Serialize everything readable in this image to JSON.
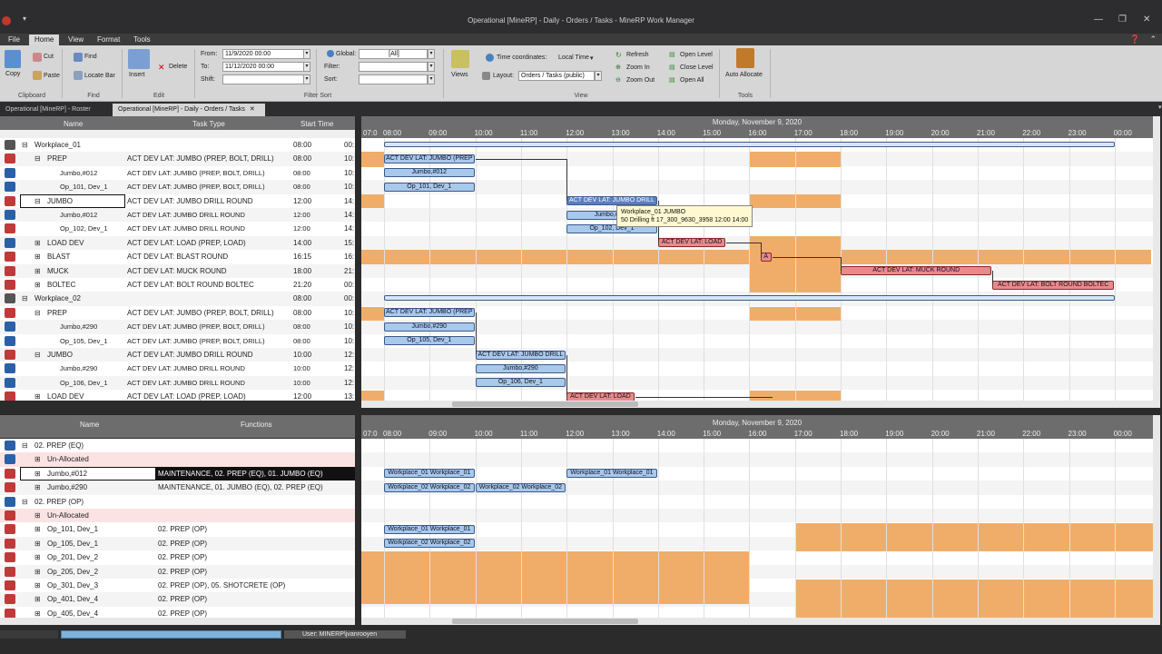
{
  "title": "Operational [MineRP] - Daily - Orders / Tasks - MineRP Work Manager",
  "menu": [
    "File",
    "Home",
    "View",
    "Format",
    "Tools"
  ],
  "ribbon": {
    "copy": "Copy",
    "cut": "Cut",
    "paste": "Paste",
    "clipboard": "Clipboard",
    "find": "Find",
    "locate_bar": "Locate Bar",
    "find_group": "Find",
    "insert": "Insert",
    "delete": "Delete",
    "edit_group": "Edit",
    "from_label": "From:",
    "from_value": "11/9/2020 00:00",
    "to_label": "To:",
    "to_value": "11/12/2020 00:00",
    "shift_label": "Shift:",
    "shift_value": "",
    "global_label": "Global:",
    "global_value": "[All]",
    "filter_label": "Filter:",
    "sort_label": "Sort:",
    "filter_sort_group": "Filter Sort",
    "views": "Views",
    "time_coord_label": "Time coordinates:",
    "time_coord_value": "Local Time",
    "layout_label": "Layout:",
    "layout_value": "Orders / Tasks (public)",
    "refresh": "Refresh",
    "zoom_in": "Zoom In",
    "zoom_out": "Zoom Out",
    "open_level": "Open Level",
    "close_level": "Close Level",
    "open_all": "Open All",
    "view_group": "View",
    "auto_allocate": "Auto Allocate",
    "tools_group": "Tools"
  },
  "tabs": [
    "Operational [MineRP] - Roster",
    "Operational [MineRP] - Daily - Orders / Tasks"
  ],
  "top_grid": {
    "headers": {
      "name": "Name",
      "task": "Task Type",
      "start": "Start Time"
    },
    "rows": [
      {
        "name": "Workplace_01",
        "task": "",
        "start": "08:00",
        "end": "00:",
        "indent": 0,
        "exp": "⊟",
        "icon": "#555"
      },
      {
        "name": "PREP",
        "task": "ACT DEV LAT: JUMBO (PREP, BOLT, DRILL)",
        "start": "08:00",
        "end": "10:",
        "indent": 1,
        "exp": "⊟",
        "icon": "#c03a3a"
      },
      {
        "name": "Jumbo,#012",
        "task": "ACT DEV LAT: JUMBO (PREP, BOLT, DRILL)",
        "start": "08:00",
        "end": "10:",
        "indent": 2,
        "exp": "",
        "icon": "#2a60a8"
      },
      {
        "name": "Op_101, Dev_1",
        "task": "ACT DEV LAT: JUMBO (PREP, BOLT, DRILL)",
        "start": "08:00",
        "end": "10:",
        "indent": 2,
        "exp": "",
        "icon": "#2a60a8"
      },
      {
        "name": "JUMBO",
        "task": "ACT DEV LAT: JUMBO DRILL ROUND",
        "start": "12:00",
        "end": "14:",
        "indent": 1,
        "exp": "⊟",
        "icon": "#c03a3a"
      },
      {
        "name": "Jumbo,#012",
        "task": "ACT DEV LAT: JUMBO DRILL ROUND",
        "start": "12:00",
        "end": "14:",
        "indent": 2,
        "exp": "",
        "icon": "#2a60a8"
      },
      {
        "name": "Op_102, Dev_1",
        "task": "ACT DEV LAT: JUMBO DRILL ROUND",
        "start": "12:00",
        "end": "14:",
        "indent": 2,
        "exp": "",
        "icon": "#c03a3a"
      },
      {
        "name": "LOAD DEV",
        "task": "ACT DEV LAT: LOAD (PREP, LOAD)",
        "start": "14:00",
        "end": "15:",
        "indent": 1,
        "exp": "⊞",
        "icon": "#2a60a8"
      },
      {
        "name": "BLAST",
        "task": "ACT DEV LAT: BLAST ROUND",
        "start": "16:15",
        "end": "16:",
        "indent": 1,
        "exp": "⊞",
        "icon": "#c03a3a"
      },
      {
        "name": "MUCK",
        "task": "ACT DEV LAT: MUCK ROUND",
        "start": "18:00",
        "end": "21:",
        "indent": 1,
        "exp": "⊞",
        "icon": "#c03a3a"
      },
      {
        "name": "BOLTEC",
        "task": "ACT DEV LAT: BOLT ROUND BOLTEC",
        "start": "21:20",
        "end": "00:",
        "indent": 1,
        "exp": "⊞",
        "icon": "#c03a3a"
      },
      {
        "name": "Workplace_02",
        "task": "",
        "start": "08:00",
        "end": "00:",
        "indent": 0,
        "exp": "⊟",
        "icon": "#555"
      },
      {
        "name": "PREP",
        "task": "ACT DEV LAT: JUMBO (PREP, BOLT, DRILL)",
        "start": "08:00",
        "end": "10:",
        "indent": 1,
        "exp": "⊟",
        "icon": "#c03a3a"
      },
      {
        "name": "Jumbo,#290",
        "task": "ACT DEV LAT: JUMBO (PREP, BOLT, DRILL)",
        "start": "08:00",
        "end": "10:",
        "indent": 2,
        "exp": "",
        "icon": "#2a60a8"
      },
      {
        "name": "Op_105, Dev_1",
        "task": "ACT DEV LAT: JUMBO (PREP, BOLT, DRILL)",
        "start": "08:00",
        "end": "10:",
        "indent": 2,
        "exp": "",
        "icon": "#2a60a8"
      },
      {
        "name": "JUMBO",
        "task": "ACT DEV LAT: JUMBO DRILL ROUND",
        "start": "10:00",
        "end": "12:",
        "indent": 1,
        "exp": "⊟",
        "icon": "#c03a3a"
      },
      {
        "name": "Jumbo,#290",
        "task": "ACT DEV LAT: JUMBO DRILL ROUND",
        "start": "10:00",
        "end": "12:",
        "indent": 2,
        "exp": "",
        "icon": "#2a60a8"
      },
      {
        "name": "Op_106, Dev_1",
        "task": "ACT DEV LAT: JUMBO DRILL ROUND",
        "start": "10:00",
        "end": "12:",
        "indent": 2,
        "exp": "",
        "icon": "#2a60a8"
      },
      {
        "name": "LOAD DEV",
        "task": "ACT DEV LAT: LOAD (PREP, LOAD)",
        "start": "12:00",
        "end": "13:",
        "indent": 1,
        "exp": "⊞",
        "icon": "#c03a3a"
      }
    ]
  },
  "bottom_grid": {
    "headers": {
      "name": "Name",
      "functions": "Functions"
    },
    "rows": [
      {
        "name": "02. PREP (EQ)",
        "func": "",
        "indent": 0,
        "exp": "⊟",
        "icon": "#2a60a8"
      },
      {
        "name": "Un-Allocated",
        "func": "",
        "indent": 1,
        "exp": "⊞",
        "icon": "#2a60a8",
        "pink": true
      },
      {
        "name": "Jumbo,#012",
        "func": "MAINTENANCE, 02. PREP (EQ), 01. JUMBO (EQ)",
        "indent": 1,
        "exp": "⊞",
        "icon": "#c03a3a",
        "sel": true
      },
      {
        "name": "Jumbo,#290",
        "func": "MAINTENANCE, 01. JUMBO (EQ), 02. PREP (EQ)",
        "indent": 1,
        "exp": "⊞",
        "icon": "#c03a3a"
      },
      {
        "name": "02. PREP (OP)",
        "func": "",
        "indent": 0,
        "exp": "⊟",
        "icon": "#2a60a8"
      },
      {
        "name": "Un-Allocated",
        "func": "",
        "indent": 1,
        "exp": "⊞",
        "icon": "#c03a3a",
        "pink": true
      },
      {
        "name": "Op_101, Dev_1",
        "func": "02. PREP (OP)",
        "indent": 1,
        "exp": "⊞",
        "icon": "#c03a3a"
      },
      {
        "name": "Op_105, Dev_1",
        "func": "02. PREP (OP)",
        "indent": 1,
        "exp": "⊞",
        "icon": "#c03a3a"
      },
      {
        "name": "Op_201, Dev_2",
        "func": "02. PREP (OP)",
        "indent": 1,
        "exp": "⊞",
        "icon": "#c03a3a"
      },
      {
        "name": "Op_205, Dev_2",
        "func": "02. PREP (OP)",
        "indent": 1,
        "exp": "⊞",
        "icon": "#c03a3a"
      },
      {
        "name": "Op_301, Dev_3",
        "func": "02. PREP (OP), 05. SHOTCRETE (OP)",
        "indent": 1,
        "exp": "⊞",
        "icon": "#c03a3a"
      },
      {
        "name": "Op_401, Dev_4",
        "func": "02. PREP (OP)",
        "indent": 1,
        "exp": "⊞",
        "icon": "#c03a3a"
      },
      {
        "name": "Op_405, Dev_4",
        "func": "02. PREP (OP)",
        "indent": 1,
        "exp": "⊞",
        "icon": "#c03a3a"
      }
    ]
  },
  "timeline": {
    "day": "Monday, November 9, 2020",
    "hours": [
      "07:0",
      "08:00",
      "09:00",
      "10:00",
      "11:00",
      "12:00",
      "13:00",
      "14:00",
      "15:00",
      "16:00",
      "17:00",
      "18:00",
      "19:00",
      "20:00",
      "21:00",
      "22:00",
      "23:00",
      "00:00"
    ]
  },
  "top_bars": [
    {
      "row": 1,
      "from": 8.0,
      "to": 10.0,
      "label": "ACT DEV LAT: JUMBO (PREP",
      "kind": ""
    },
    {
      "row": 2,
      "from": 8.0,
      "to": 10.0,
      "label": "Jumbo,#012",
      "kind": ""
    },
    {
      "row": 3,
      "from": 8.0,
      "to": 10.0,
      "label": "Op_101, Dev_1",
      "kind": ""
    },
    {
      "row": 4,
      "from": 12.0,
      "to": 14.0,
      "label": "ACT DEV LAT: JUMBO DRILL",
      "kind": "blu"
    },
    {
      "row": 5,
      "from": 12.0,
      "to": 14.0,
      "label": "Jumbo,#012",
      "kind": ""
    },
    {
      "row": 6,
      "from": 12.0,
      "to": 14.0,
      "label": "Op_102, Dev_1",
      "kind": ""
    },
    {
      "row": 7,
      "from": 14.0,
      "to": 15.5,
      "label": "ACT DEV LAT: LOAD",
      "kind": "red"
    },
    {
      "row": 8,
      "from": 16.25,
      "to": 16.5,
      "label": "A",
      "kind": "red"
    },
    {
      "row": 9,
      "from": 18.0,
      "to": 21.33,
      "label": "ACT DEV LAT: MUCK ROUND",
      "kind": "red"
    },
    {
      "row": 10,
      "from": 21.33,
      "to": 24.0,
      "label": "ACT DEV LAT: BOLT ROUND BOLTEC",
      "kind": "red"
    },
    {
      "row": 12,
      "from": 8.0,
      "to": 10.0,
      "label": "ACT DEV LAT: JUMBO (PREP",
      "kind": ""
    },
    {
      "row": 13,
      "from": 8.0,
      "to": 10.0,
      "label": "Jumbo,#290",
      "kind": ""
    },
    {
      "row": 14,
      "from": 8.0,
      "to": 10.0,
      "label": "Op_105, Dev_1",
      "kind": ""
    },
    {
      "row": 15,
      "from": 10.0,
      "to": 12.0,
      "label": "ACT DEV LAT: JUMBO DRILL",
      "kind": ""
    },
    {
      "row": 16,
      "from": 10.0,
      "to": 12.0,
      "label": "Jumbo,#290",
      "kind": ""
    },
    {
      "row": 17,
      "from": 10.0,
      "to": 12.0,
      "label": "Op_106, Dev_1",
      "kind": ""
    },
    {
      "row": 18,
      "from": 12.0,
      "to": 13.5,
      "label": "ACT DEV LAT: LOAD",
      "kind": "red"
    }
  ],
  "bottom_bars": [
    {
      "row": 2,
      "from": 8.0,
      "to": 10.0,
      "label": "Workplace_01 Workplace_01"
    },
    {
      "row": 2,
      "from": 12.0,
      "to": 14.0,
      "label": "Workplace_01 Workplace_01"
    },
    {
      "row": 3,
      "from": 8.0,
      "to": 10.0,
      "label": "Workplace_02 Workplace_02"
    },
    {
      "row": 3,
      "from": 10.0,
      "to": 12.0,
      "label": "Workplace_02 Workplace_02"
    },
    {
      "row": 6,
      "from": 8.0,
      "to": 10.0,
      "label": "Workplace_01 Workplace_01"
    },
    {
      "row": 7,
      "from": 8.0,
      "to": 10.0,
      "label": "Workplace_02 Workplace_02"
    }
  ],
  "tooltip": {
    "line1": "Workplace_01 JUMBO",
    "line2": "50 Drilling ft 17_300_9630_3958  12:00 14:00"
  },
  "status": {
    "user": "User: MINERP\\jvanrooyen"
  },
  "colors": {
    "accent": "#f0ad6a",
    "bar": "#a8c8ec",
    "bar_red": "#e88a8a",
    "header": "#6d6d6d"
  }
}
